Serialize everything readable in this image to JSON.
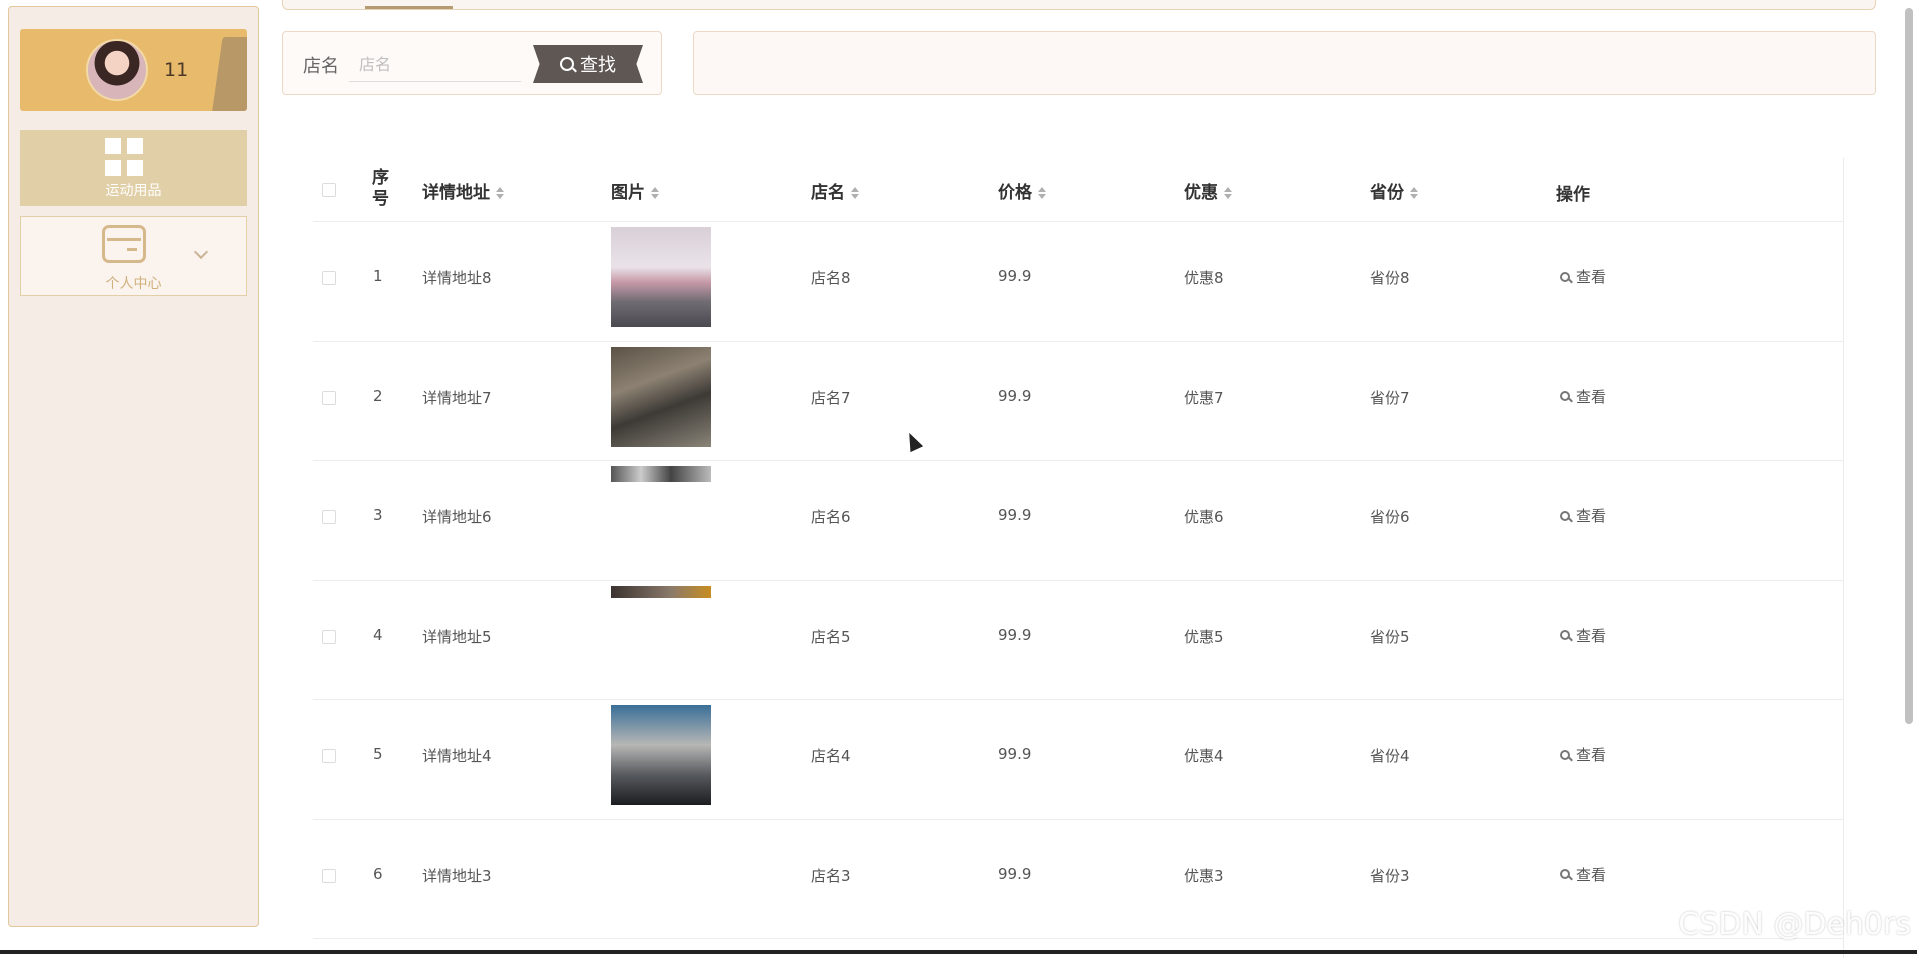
{
  "sidebar": {
    "user": {
      "name": "11"
    },
    "menu": [
      {
        "label": "运动用品",
        "icon": "grid-icon"
      },
      {
        "label": "个人中心",
        "icon": "card-icon"
      }
    ]
  },
  "search": {
    "label": "店名",
    "placeholder": "店名",
    "button_label": "查找"
  },
  "table": {
    "headers": {
      "index": "序号",
      "address": "详情地址",
      "image": "图片",
      "store": "店名",
      "price": "价格",
      "discount": "优惠",
      "province": "省份",
      "action": "操作"
    },
    "rows": [
      {
        "index": "1",
        "address": "详情地址8",
        "store": "店名8",
        "price": "99.9",
        "discount": "优惠8",
        "province": "省份8",
        "action": "查看",
        "image": "woman-stretching-photo"
      },
      {
        "index": "2",
        "address": "详情地址7",
        "store": "店名7",
        "price": "99.9",
        "discount": "优惠7",
        "province": "省份7",
        "action": "查看",
        "image": "woman-dumbbells-gym-photo"
      },
      {
        "index": "3",
        "address": "详情地址6",
        "store": "店名6",
        "price": "99.9",
        "discount": "优惠6",
        "province": "省份6",
        "action": "查看",
        "image": "gym-weights-photo-partial"
      },
      {
        "index": "4",
        "address": "详情地址5",
        "store": "店名5",
        "price": "99.9",
        "discount": "优惠5",
        "province": "省份5",
        "action": "查看",
        "image": "gym-photo-partial"
      },
      {
        "index": "5",
        "address": "详情地址4",
        "store": "店名4",
        "price": "99.9",
        "discount": "优惠4",
        "province": "省份4",
        "action": "查看",
        "image": "woman-treadmill-photo"
      },
      {
        "index": "6",
        "address": "详情地址3",
        "store": "店名3",
        "price": "99.9",
        "discount": "优惠3",
        "province": "省份3",
        "action": "查看",
        "image": ""
      }
    ]
  },
  "watermark": "CSDN @Deh0rs"
}
